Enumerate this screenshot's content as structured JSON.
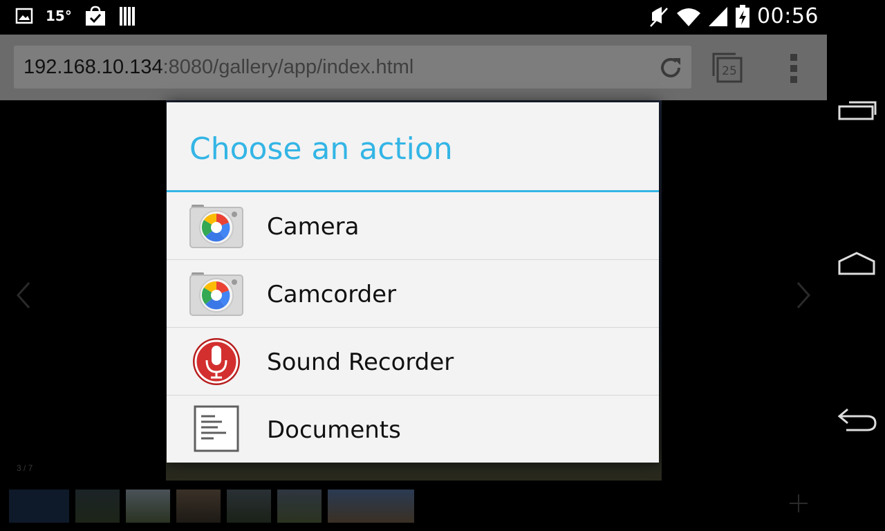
{
  "status_bar": {
    "temperature": "15°",
    "time": "00:56",
    "icons": [
      "gallery-notification-icon",
      "shopping-bag-check-icon",
      "barcode-icon",
      "mute-icon",
      "wifi-icon",
      "signal-icon",
      "battery-charging-icon"
    ]
  },
  "browser": {
    "url_host": "192.168.10.134",
    "url_path": ":8080/gallery/app/index.html",
    "tab_count": "25",
    "icons": [
      "reload-icon",
      "tabs-icon",
      "overflow-menu-icon"
    ]
  },
  "gallery": {
    "counter": "3 / 7",
    "thumbnail_count": 7
  },
  "dialog": {
    "title": "Choose an action",
    "items": [
      {
        "label": "Camera",
        "icon": "camera-app-icon"
      },
      {
        "label": "Camcorder",
        "icon": "camcorder-app-icon"
      },
      {
        "label": "Sound Recorder",
        "icon": "microphone-app-icon"
      },
      {
        "label": "Documents",
        "icon": "documents-app-icon"
      }
    ]
  },
  "colors": {
    "accent": "#33b5e5",
    "dialog_bg": "#f3f3f3",
    "toolbar_bg": "#6b6b6b"
  },
  "navbar": {
    "icons": [
      "recent-apps-icon",
      "home-icon",
      "back-icon"
    ]
  }
}
